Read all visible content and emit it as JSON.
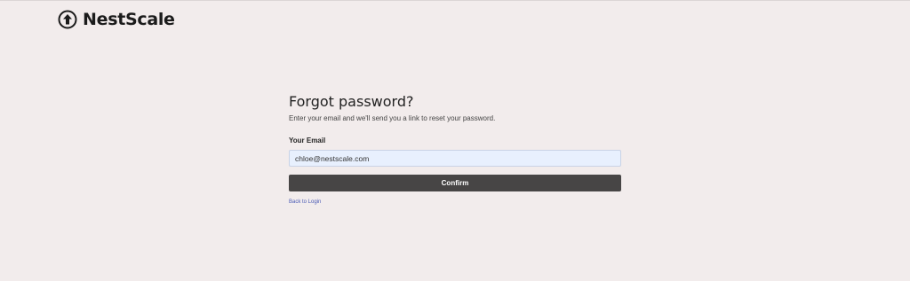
{
  "brand": {
    "name": "NestScale",
    "icon": "nestscale-logo-icon"
  },
  "form": {
    "title": "Forgot password?",
    "subtitle": "Enter your email and we'll send you a link to reset your password.",
    "email_label": "Your Email",
    "email_value": "chloe@nestscale.com",
    "confirm_label": "Confirm",
    "back_link": "Back to Login"
  },
  "colors": {
    "background": "#f2ecec",
    "button": "#474545",
    "input_fill": "#e8f0fe",
    "link": "#4b5bb5"
  }
}
